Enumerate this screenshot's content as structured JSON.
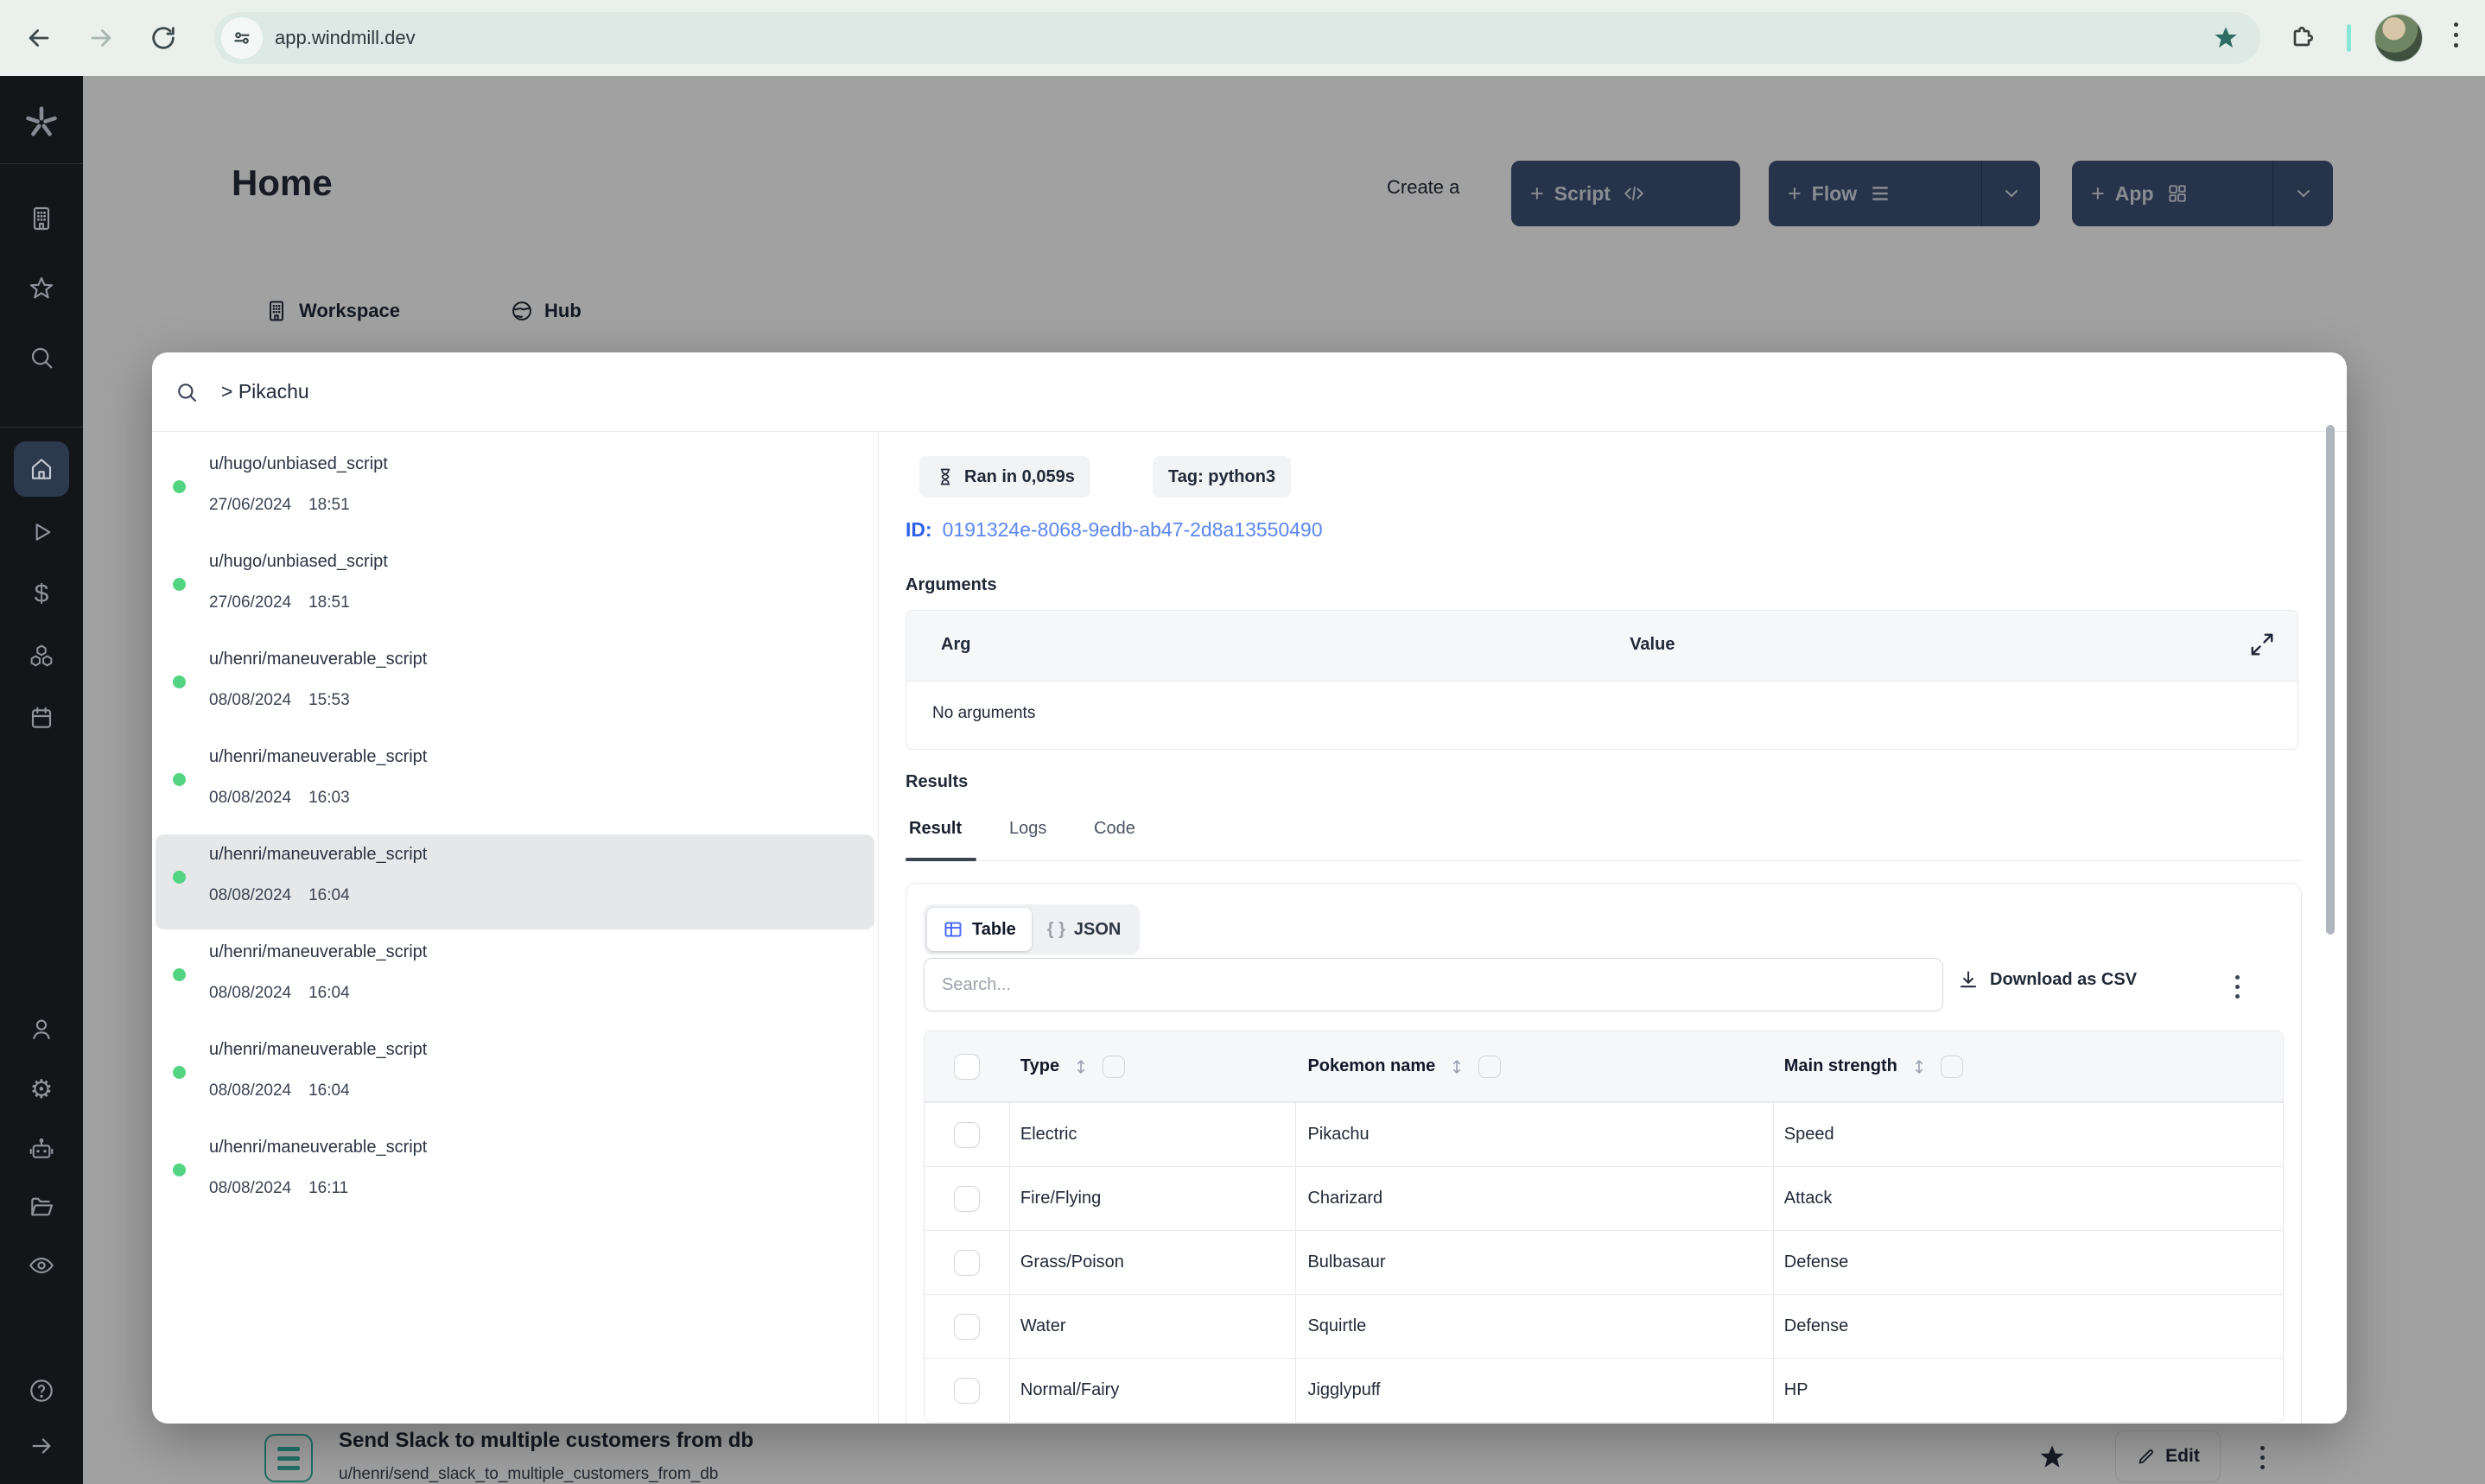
{
  "browser": {
    "url": "app.windmill.dev"
  },
  "sidebar": {
    "icons": [
      "windmill-logo",
      "workspace",
      "favorites",
      "search",
      "home",
      "runs",
      "variables",
      "resources",
      "schedules",
      "users",
      "settings",
      "workers",
      "folders",
      "audit-logs",
      "help",
      "collapse"
    ]
  },
  "header": {
    "title": "Home",
    "create_label": "Create a",
    "script_button": "Script",
    "flow_button": "Flow",
    "app_button": "App",
    "tabs": [
      {
        "label": "Workspace"
      },
      {
        "label": "Hub"
      }
    ]
  },
  "modal": {
    "search_value": "> Pikachu",
    "runs": [
      {
        "path": "u/hugo/unbiased_script",
        "date": "27/06/2024",
        "time": "18:51"
      },
      {
        "path": "u/hugo/unbiased_script",
        "date": "27/06/2024",
        "time": "18:51"
      },
      {
        "path": "u/henri/maneuverable_script",
        "date": "08/08/2024",
        "time": "15:53"
      },
      {
        "path": "u/henri/maneuverable_script",
        "date": "08/08/2024",
        "time": "16:03"
      },
      {
        "path": "u/henri/maneuverable_script",
        "date": "08/08/2024",
        "time": "16:04"
      },
      {
        "path": "u/henri/maneuverable_script",
        "date": "08/08/2024",
        "time": "16:04"
      },
      {
        "path": "u/henri/maneuverable_script",
        "date": "08/08/2024",
        "time": "16:04"
      },
      {
        "path": "u/henri/maneuverable_script",
        "date": "08/08/2024",
        "time": "16:11"
      }
    ],
    "detail": {
      "ran_badge": "Ran in 0,059s",
      "tag_badge": "Tag: python3",
      "id_label": "ID:",
      "id_value": "0191324e-8068-9edb-ab47-2d8a13550490",
      "arguments_title": "Arguments",
      "args_table": {
        "col_arg": "Arg",
        "col_value": "Value",
        "empty": "No arguments"
      },
      "results_title": "Results",
      "tabs": [
        {
          "label": "Result"
        },
        {
          "label": "Logs"
        },
        {
          "label": "Code"
        }
      ],
      "view_table": "Table",
      "view_json": "JSON",
      "braces": "{ }",
      "search_placeholder": "Search...",
      "download_label": "Download as CSV",
      "table": {
        "columns": [
          "Type",
          "Pokemon name",
          "Main strength"
        ],
        "rows": [
          {
            "type": "Electric",
            "name": "Pikachu",
            "strength": "Speed"
          },
          {
            "type": "Fire/Flying",
            "name": "Charizard",
            "strength": "Attack"
          },
          {
            "type": "Grass/Poison",
            "name": "Bulbasaur",
            "strength": "Defense"
          },
          {
            "type": "Water",
            "name": "Squirtle",
            "strength": "Defense"
          },
          {
            "type": "Normal/Fairy",
            "name": "Jigglypuff",
            "strength": "HP"
          }
        ]
      }
    }
  },
  "footer_item": {
    "title": "Send Slack to multiple customers from db",
    "path": "u/henri/send_slack_to_multiple_customers_from_db",
    "edit_label": "Edit"
  },
  "colors": {
    "accent_blue": "#4a6bf5",
    "link_blue": "#5a86f0",
    "success_green": "#53d482",
    "teal": "#34b2a2",
    "dark_button": "#3f5276"
  }
}
